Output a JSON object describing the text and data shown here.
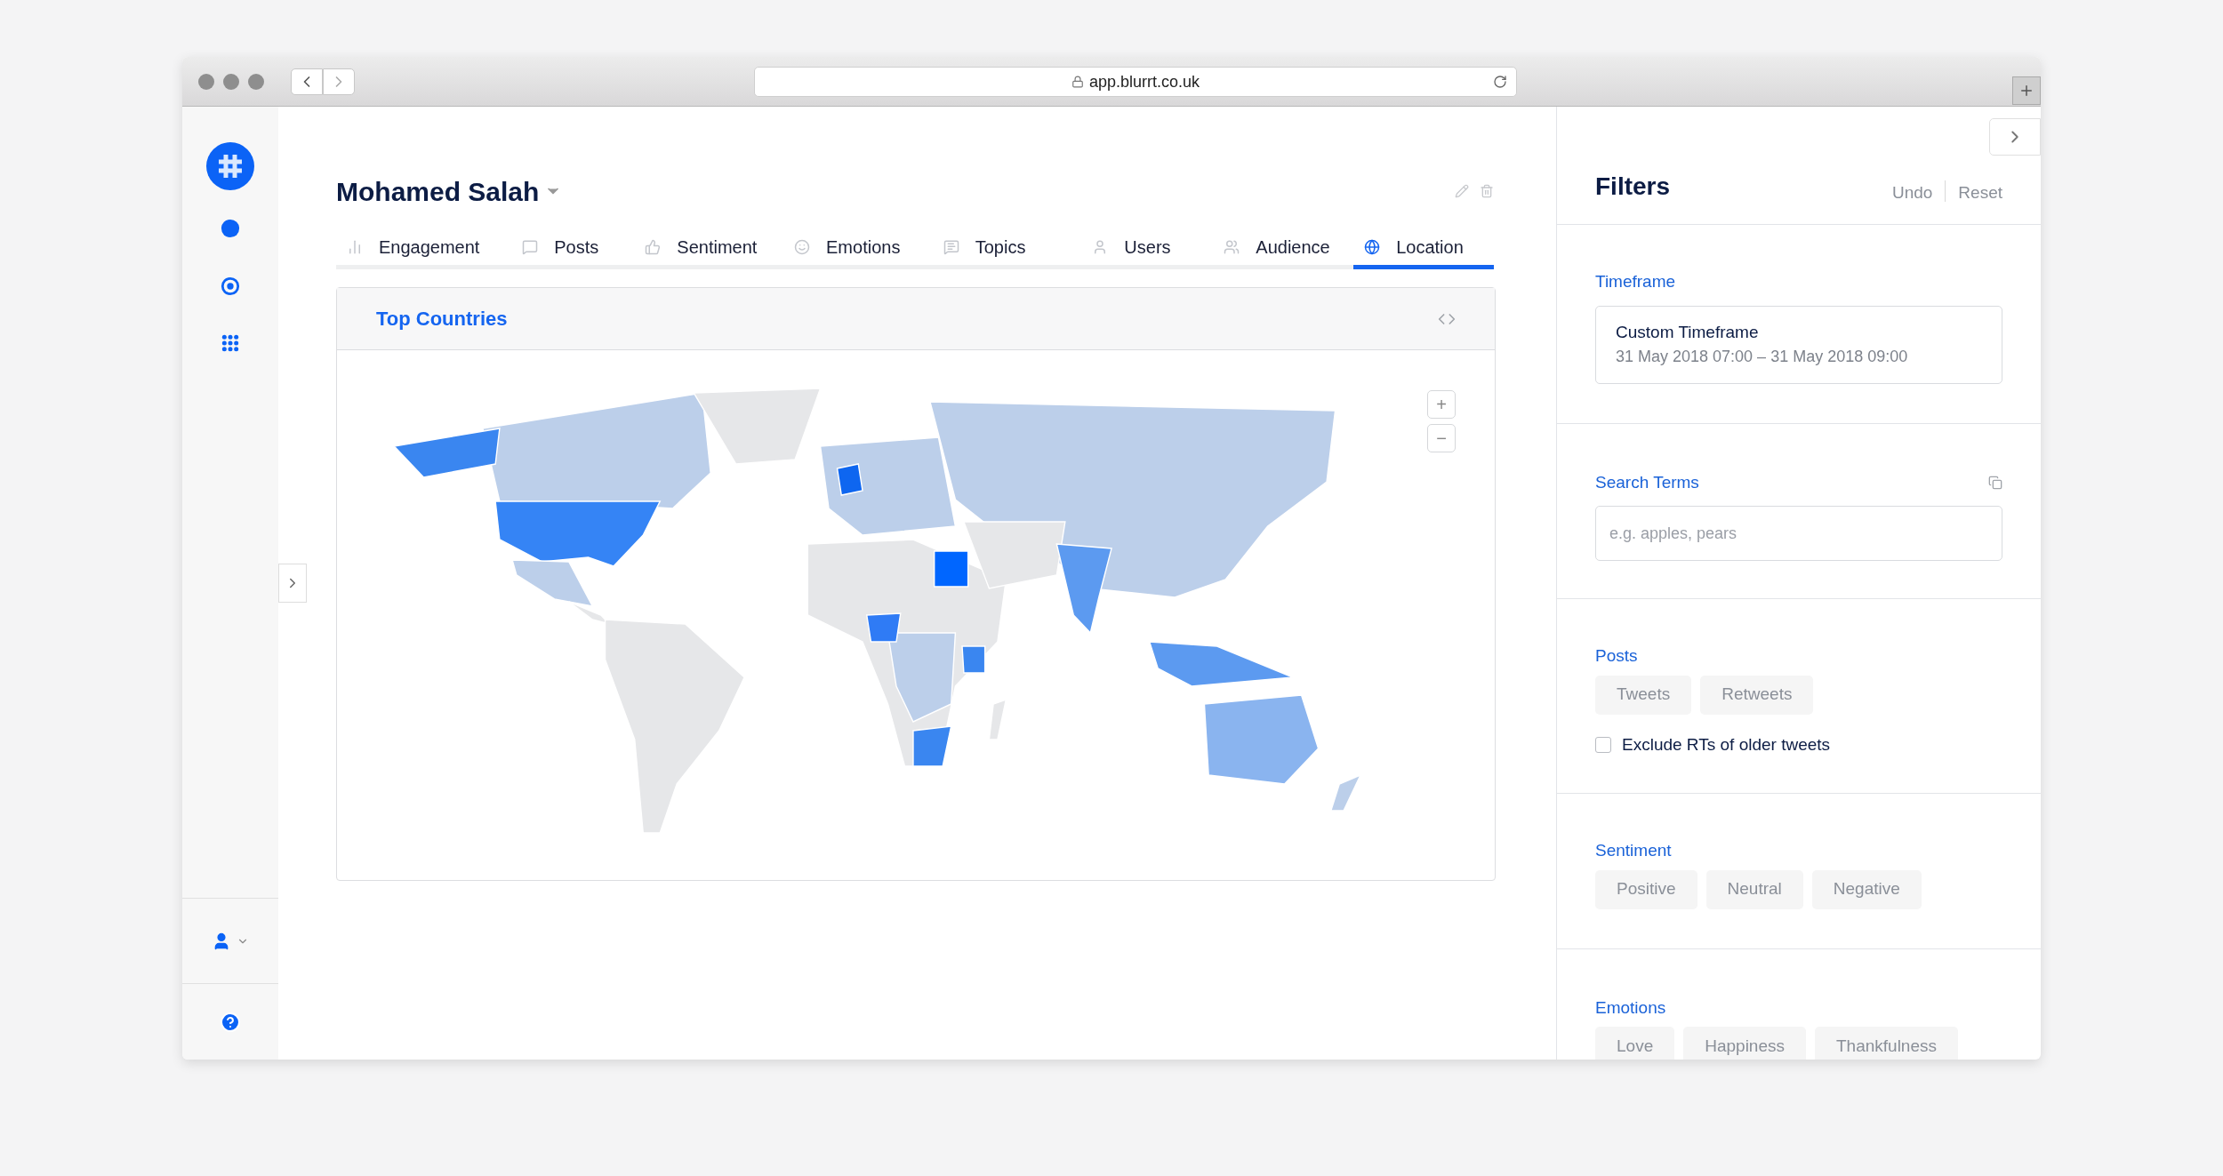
{
  "browser": {
    "url": "app.blurrt.co.uk"
  },
  "page": {
    "title": "Mohamed Salah"
  },
  "tabs": [
    {
      "label": "Engagement",
      "selected": false
    },
    {
      "label": "Posts",
      "selected": false
    },
    {
      "label": "Sentiment",
      "selected": false
    },
    {
      "label": "Emotions",
      "selected": false
    },
    {
      "label": "Topics",
      "selected": false
    },
    {
      "label": "Users",
      "selected": false
    },
    {
      "label": "Audience",
      "selected": false
    },
    {
      "label": "Location",
      "selected": true
    }
  ],
  "card": {
    "title": "Top Countries",
    "zoom_buttons": [
      "+",
      "−"
    ]
  },
  "filters": {
    "title": "Filters",
    "actions": [
      "Undo",
      "Reset"
    ],
    "timeframe": {
      "label": "Timeframe",
      "name": "Custom Timeframe",
      "range": "31 May 2018 07:00 – 31 May 2018 09:00"
    },
    "search_terms": {
      "label": "Search Terms",
      "placeholder": "e.g. apples, pears"
    },
    "posts": {
      "label": "Posts",
      "options": [
        {
          "label": "Tweets",
          "selected": false
        },
        {
          "label": "Retweets",
          "selected": false
        }
      ],
      "exclude_rts": {
        "label": "Exclude RTs of older tweets",
        "checked": false
      }
    },
    "sentiment": {
      "label": "Sentiment",
      "options": [
        {
          "label": "Positive",
          "selected": false
        },
        {
          "label": "Neutral",
          "selected": false
        },
        {
          "label": "Negative",
          "selected": false
        }
      ]
    },
    "emotions": {
      "label": "Emotions",
      "options": [
        {
          "label": "Love",
          "selected": false
        },
        {
          "label": "Happiness",
          "selected": false
        },
        {
          "label": "Thankfulness",
          "selected": false
        }
      ]
    }
  }
}
